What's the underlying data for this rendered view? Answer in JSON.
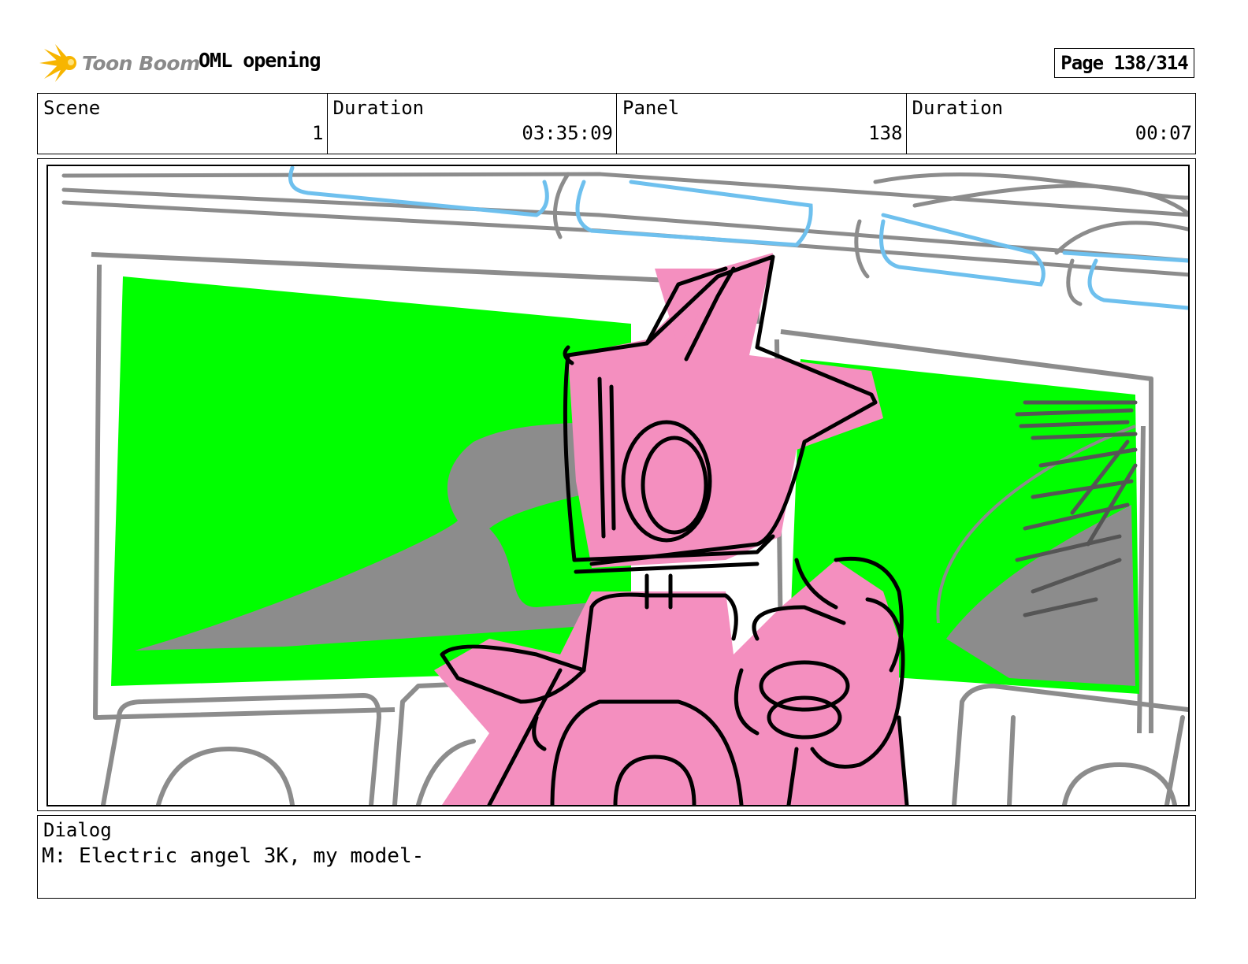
{
  "header": {
    "logo_text": "Toon Boom",
    "project_title": "OML opening",
    "page_label": "Page 138/314"
  },
  "info": {
    "scene_label": "Scene",
    "scene_value": "1",
    "duration_label": "Duration",
    "duration_value": "03:35:09",
    "panel_label": "Panel",
    "panel_value": "138",
    "panel_duration_label": "Duration",
    "panel_duration_value": "00:07"
  },
  "dialog": {
    "label": "Dialog",
    "text": "M: Electric angel 3K, my model-"
  },
  "colors": {
    "screen_green": "#00ff00",
    "character_pink": "#f48fbf",
    "sketch_gray": "#8c8c8c",
    "sketch_blue": "#6ec0ee",
    "logo_yellow": "#f7b500"
  }
}
